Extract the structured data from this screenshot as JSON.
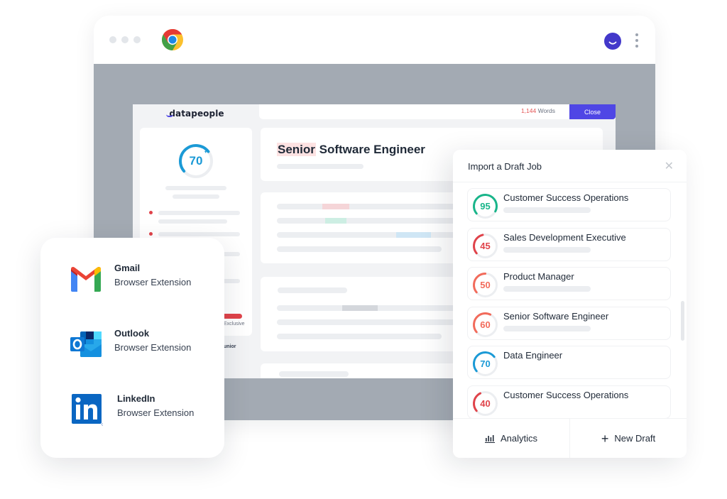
{
  "browser": {
    "icons": {
      "app": "chrome-icon",
      "profile": "profile-smile-icon",
      "menu": "kebab-menu-icon"
    }
  },
  "app": {
    "logo": "datapeople",
    "word_count": {
      "number": "1,144",
      "label": " Words"
    },
    "close_label": "Close",
    "score": {
      "value": "70",
      "fraction": 0.7,
      "color": "#1b9ad6"
    },
    "job_title": {
      "highlight": "Senior",
      "rest": " Software Engineer"
    },
    "sidebar_text": {
      "exclusive": "Exclusive",
      "junior": "unior"
    },
    "colors": {
      "accent": "#4f46e5",
      "danger": "#e0434a"
    }
  },
  "extensions": {
    "items": [
      {
        "name": "Gmail",
        "subtitle": "Browser Extension",
        "icon": "gmail-icon"
      },
      {
        "name": "Outlook",
        "subtitle": "Browser Extension",
        "icon": "outlook-icon"
      },
      {
        "name": "LinkedIn",
        "subtitle": "Browser Extension",
        "icon": "linkedin-icon"
      }
    ]
  },
  "import_panel": {
    "title": "Import a Draft Job",
    "close_icon": "close-icon",
    "jobs": [
      {
        "title": "Customer Success Operations",
        "score": "95",
        "fraction": 0.95,
        "color": "#19b58a"
      },
      {
        "title": "Sales Development Executive",
        "score": "45",
        "fraction": 0.45,
        "color": "#e0434a"
      },
      {
        "title": "Product Manager",
        "score": "50",
        "fraction": 0.5,
        "color": "#f26b5b"
      },
      {
        "title": "Senior Software Engineer",
        "score": "60",
        "fraction": 0.6,
        "color": "#f26b5b"
      },
      {
        "title": "Data Engineer",
        "score": "70",
        "fraction": 0.7,
        "color": "#1b9ad6"
      },
      {
        "title": "Customer Success Operations",
        "score": "40",
        "fraction": 0.4,
        "color": "#e0434a"
      }
    ],
    "footer": {
      "analytics_label": "Analytics",
      "new_draft_label": "New Draft",
      "new_draft_symbol": "+"
    }
  }
}
